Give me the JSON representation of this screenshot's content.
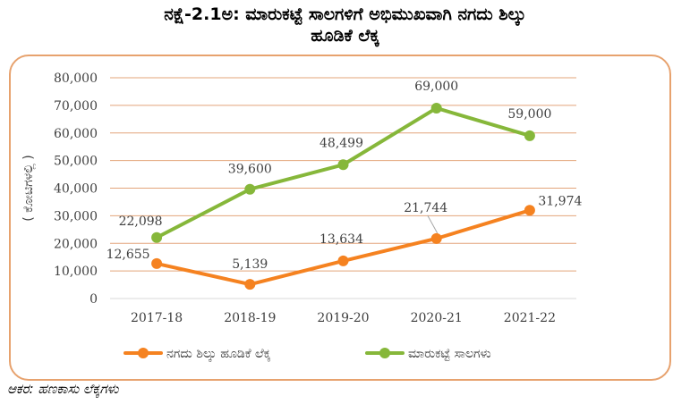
{
  "title_line1": "ನಕ್ಷೆ-2.1ಅ: ಮಾರುಕಟ್ಟೆ ಸಾಲಗಳಿಗೆ ಅಭಿಮುಖವಾಗಿ ನಗದು ಶಿಲ್ಕು",
  "title_line2": "ಹೂಡಿಕೆ ಲೆಕ್ಕ",
  "source": "ಆಕರ: ಹಣಕಾಸು ಲೆಕ್ಕಗಳು",
  "colors": {
    "frame": "#e7a26e",
    "orange": "#f58220",
    "green": "#86b73a",
    "grid": "#e3a47a"
  },
  "chart_data": {
    "type": "line",
    "title": "ನಕ್ಷೆ-2.1ಅ: ಮಾರುಕಟ್ಟೆ ಸಾಲಗಳಿಗೆ ಅಭಿಮುಖವಾಗಿ ನಗದು ಶಿಲ್ಕು ಹೂಡಿಕೆ ಲೆಕ್ಕ",
    "xlabel": "",
    "ylabel": "( ಕೋಟಿಗಳಲ್ಲಿ )",
    "categories": [
      "2017-18",
      "2018-19",
      "2019-20",
      "2020-21",
      "2021-22"
    ],
    "ylim": [
      0,
      80000
    ],
    "yticks": [
      0,
      10000,
      20000,
      30000,
      40000,
      50000,
      60000,
      70000,
      80000
    ],
    "ytick_labels": [
      "0",
      "10,000",
      "20,000",
      "30,000",
      "40,000",
      "50,000",
      "60,000",
      "70,000",
      "80,000"
    ],
    "grid": true,
    "legend": "bottom",
    "series": [
      {
        "name": "ನಗದು ಶಿಲ್ಕು ಹೂಡಿಕೆ ಲೆಕ್ಕ",
        "color": "#f58220",
        "values": [
          12655,
          5139,
          13634,
          21744,
          31974
        ],
        "labels": [
          "12,655",
          "5,139",
          "13,634",
          "21,744",
          "31,974"
        ]
      },
      {
        "name": "ಮಾರುಕಟ್ಟೆ ಸಾಲಗಳು",
        "color": "#86b73a",
        "values": [
          22098,
          39600,
          48499,
          69000,
          59000
        ],
        "labels": [
          "22,098",
          "39,600",
          "48,499",
          "69,000",
          "59,000"
        ]
      }
    ]
  }
}
